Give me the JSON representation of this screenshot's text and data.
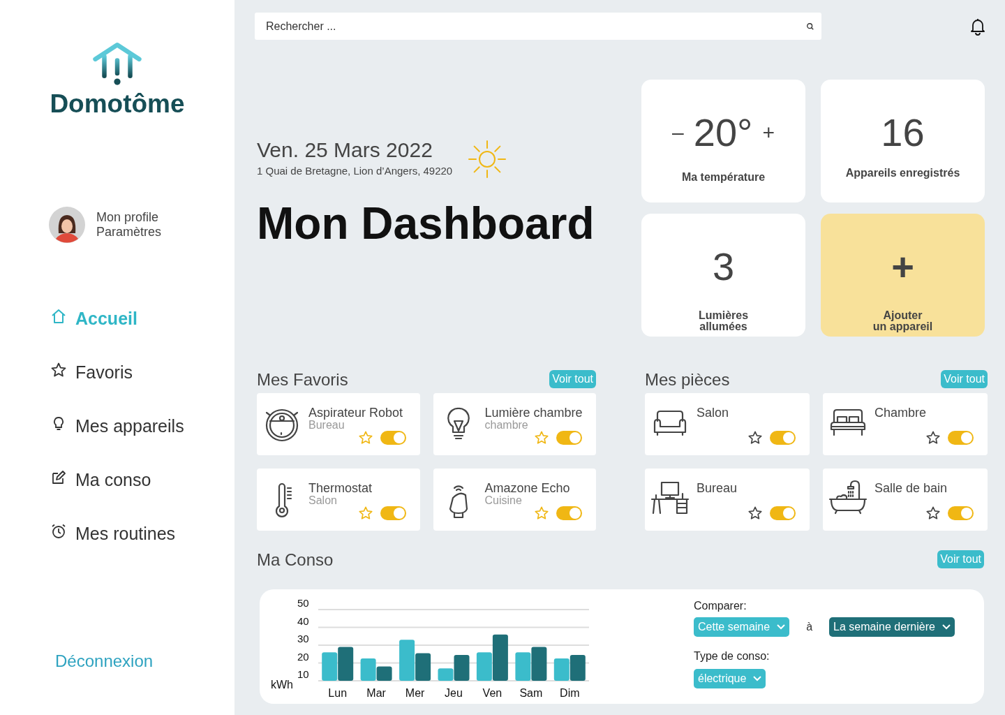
{
  "sidebar": {
    "logo": "Domotôme",
    "profile": {
      "name": "Mon profile",
      "settings": "Paramètres"
    },
    "nav": [
      {
        "label": "Accueil",
        "selected": true
      },
      {
        "label": "Favoris",
        "selected": false
      },
      {
        "label": "Mes appareils",
        "selected": false
      },
      {
        "label": "Ma conso",
        "selected": false
      },
      {
        "label": "Mes routines",
        "selected": false
      }
    ],
    "logout": "Déconnexion"
  },
  "search": {
    "placeholder": "Rechercher ..."
  },
  "header": {
    "date": "Ven. 25 Mars 2022",
    "address": "1 Quai de Bretagne, Lion d’Angers, 49220",
    "title": "Mon Dashboard"
  },
  "stats": [
    {
      "kind": "temperature",
      "minus": "–",
      "value": "20°",
      "plus": "+",
      "label_lines": [
        "Ma température"
      ]
    },
    {
      "kind": "count",
      "value": "16",
      "label_lines": [
        "Appareils enregistrés"
      ]
    },
    {
      "kind": "count",
      "value": "3",
      "label_lines": [
        "Lumières",
        "allumées"
      ]
    },
    {
      "kind": "add",
      "value": "+",
      "label_lines": [
        "Ajouter",
        "un appareil"
      ]
    }
  ],
  "favorites": {
    "title": "Mes Favoris",
    "link": "Voir tout",
    "items": [
      {
        "name": "Aspirateur Robot",
        "room": "Bureau",
        "favorite": true,
        "on": true
      },
      {
        "name": "Lumière chambre",
        "room": "chambre",
        "favorite": true,
        "on": true
      },
      {
        "name": "Thermostat",
        "room": "Salon",
        "favorite": true,
        "on": true
      },
      {
        "name": "Amazone Echo",
        "room": "Cuisine",
        "favorite": true,
        "on": true
      }
    ]
  },
  "rooms": {
    "title": "Mes pièces",
    "link": "Voir tout",
    "items": [
      {
        "name": "Salon",
        "favorite": false,
        "on": true
      },
      {
        "name": "Chambre",
        "favorite": false,
        "on": true
      },
      {
        "name": "Bureau",
        "favorite": false,
        "on": true
      },
      {
        "name": "Salle de bain",
        "favorite": false,
        "on": true
      }
    ]
  },
  "conso": {
    "title": "Ma Conso",
    "link": "Voir tout",
    "chart_data": {
      "type": "bar",
      "grid": true,
      "ylabel": "kWh",
      "categories": [
        "Lun",
        "Mar",
        "Mer",
        "Jeu",
        "Ven",
        "Sam",
        "Dim"
      ],
      "ylim": [
        10,
        50
      ],
      "yticks": [
        10,
        20,
        30,
        40,
        50
      ],
      "series": [
        {
          "color": "#3bbccb",
          "values": [
            26,
            22.5,
            33,
            17,
            26,
            26,
            22.5
          ]
        },
        {
          "color": "#1f6f78",
          "values": [
            29,
            18,
            25.5,
            24.5,
            36,
            29,
            24.5
          ]
        }
      ]
    },
    "compare_label": "Comparer:",
    "connector": "à",
    "compare": [
      {
        "label": "Cette semaine",
        "color": "#3bbccb"
      },
      {
        "label": "La semaine dernière",
        "color": "#1f6f78"
      }
    ],
    "type_label": "Type de conso:",
    "type": "électrique"
  }
}
